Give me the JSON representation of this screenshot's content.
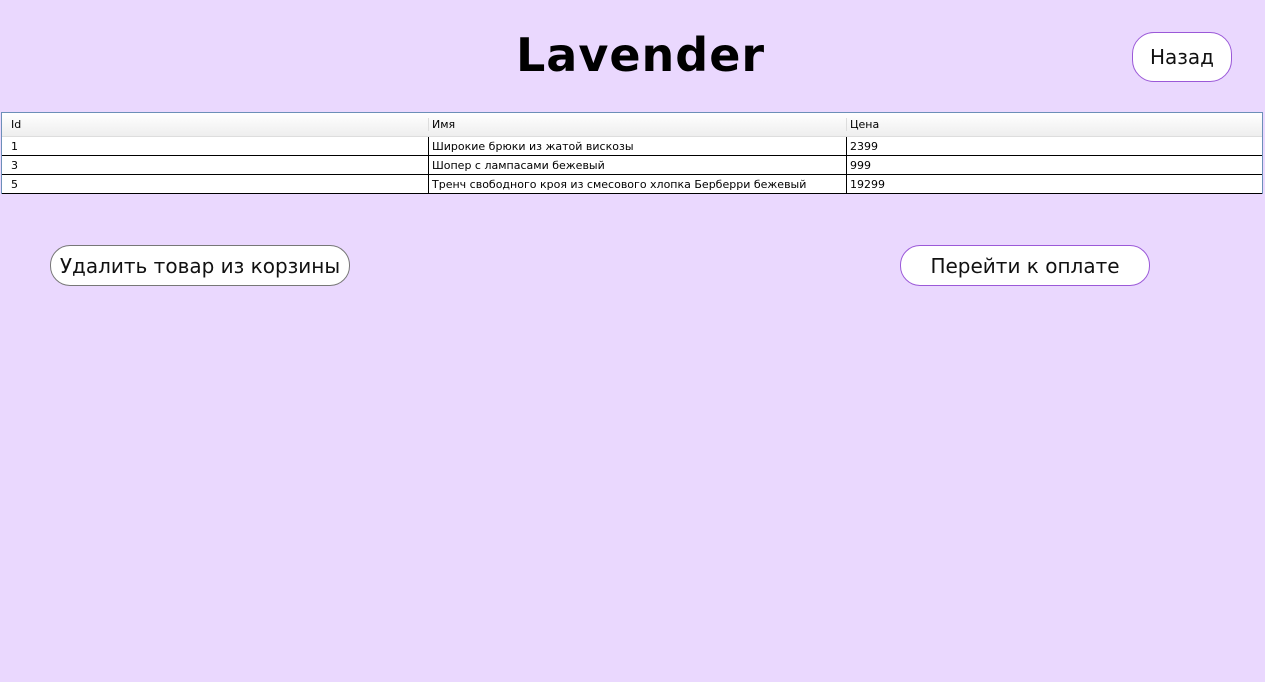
{
  "app": {
    "title": "Lavender"
  },
  "buttons": {
    "back": "Назад",
    "remove": "Удалить товар из корзины",
    "pay": "Перейти к оплате"
  },
  "table": {
    "columns": [
      "Id",
      "Имя",
      "Цена"
    ],
    "rows": [
      [
        "1",
        "Широкие брюки из жатой вискозы",
        "2399"
      ],
      [
        "3",
        "Шопер с лампасами бежевый",
        "999"
      ],
      [
        "5",
        "Тренч свободного кроя из смесового хлопка Берберри бежевый",
        "19299"
      ]
    ]
  }
}
